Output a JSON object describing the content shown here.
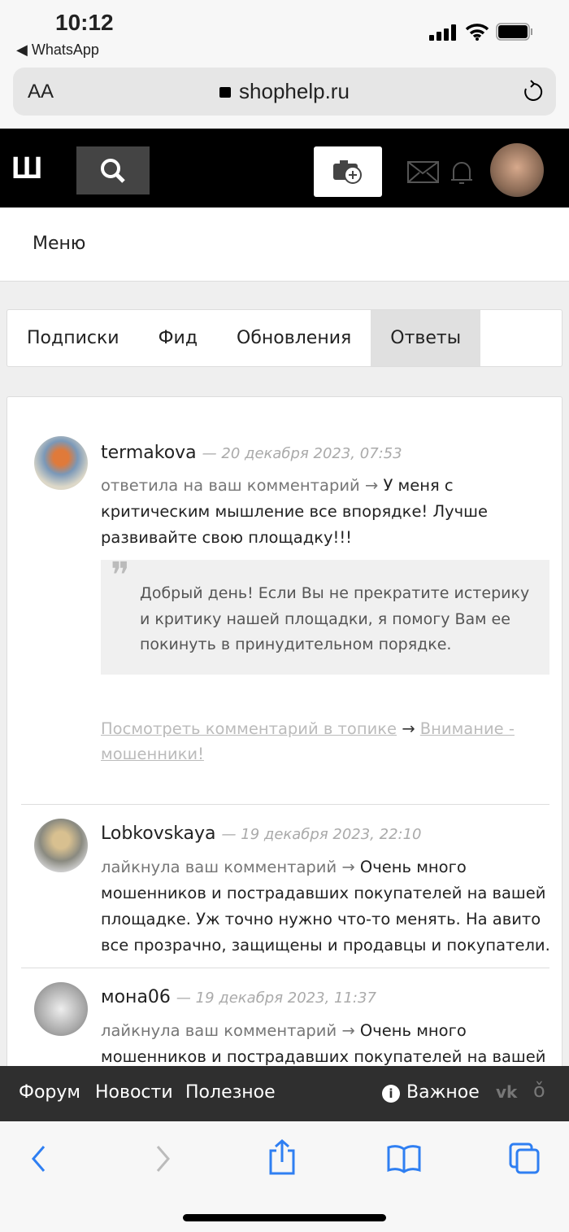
{
  "status": {
    "time": "10:12",
    "back_app": "◀ WhatsApp"
  },
  "browser": {
    "text_size": "AA",
    "url": "shophelp.ru"
  },
  "header": {
    "logo": "Ш"
  },
  "menu": {
    "label": "Меню"
  },
  "tabs": [
    {
      "label": "Подписки"
    },
    {
      "label": "Фид"
    },
    {
      "label": "Обновления"
    },
    {
      "label": "Ответы",
      "active": true
    }
  ],
  "items": [
    {
      "user": "termakova",
      "date": "— 20 декабря 2023, 07:53",
      "action": "ответила на ваш комментарий →",
      "text": " У меня с критическим мышление все впорядке! Лучше развивайте свою площадку!!!",
      "quote": "Добрый день! Если Вы не прекратите истерику и критику нашей площадки, я помогу Вам ее покинуть в принудительном порядке.",
      "link1": "Посмотреть комментарий в топике",
      "arrow": " → ",
      "link2": "Внимание - мошенники!"
    },
    {
      "user": "Lobkovskaya",
      "date": "— 19 декабря 2023, 22:10",
      "action": "лайкнула ваш комментарий →",
      "text": " Очень много мошенников и пострадавших покупателей на вашей площадке. Уж точно нужно что-то менять. На авито все прозрачно, защищены и продавцы и покупатели."
    },
    {
      "user": "мона06",
      "date": "— 19 декабря 2023, 11:37",
      "action": "лайкнула ваш комментарий →",
      "text": " Очень много мошенников и пострадавших покупателей на вашей площадке."
    }
  ],
  "footer": {
    "forum": "Форум",
    "news": "Новости",
    "useful": "Полезное",
    "important": "Важное"
  },
  "colors": {
    "accent": "#2f7ff2",
    "header_bg": "#000000",
    "footer_bg": "#2f2f2f"
  }
}
